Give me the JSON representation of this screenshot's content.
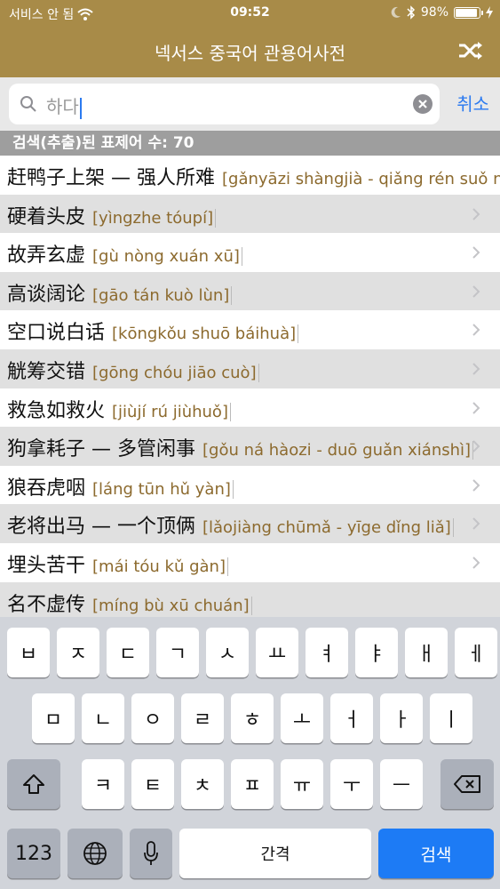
{
  "status": {
    "carrier": "서비스 안 됨",
    "time": "09:52",
    "battery_percent": "98%",
    "battery_level": 0.98
  },
  "nav": {
    "title": "넥서스 중국어 관용어사전",
    "shuffle_icon": "shuffle-icon"
  },
  "search": {
    "query": "하다",
    "cancel_label": "취소"
  },
  "count_label": "검색(추출)된 표제어 수: 70",
  "entries": [
    {
      "hanzi": "赶鸭子上架 — 强人所难",
      "pinyin": "[gǎnyāzi shàngjià - qiǎng rén suǒ nán]"
    },
    {
      "hanzi": "硬着头皮",
      "pinyin": "[yìngzhe tóupí]"
    },
    {
      "hanzi": "故弄玄虚",
      "pinyin": "[gù nòng xuán xū]"
    },
    {
      "hanzi": "高谈阔论",
      "pinyin": "[gāo tán kuò lùn]"
    },
    {
      "hanzi": "空口说白话",
      "pinyin": "[kōngkǒu shuō báihuà]"
    },
    {
      "hanzi": "觥筹交错",
      "pinyin": "[gōng chóu jiāo cuò]"
    },
    {
      "hanzi": "救急如救火",
      "pinyin": "[jiùjí rú jiùhuǒ]"
    },
    {
      "hanzi": "狗拿耗子 — 多管闲事",
      "pinyin": "[gǒu ná hàozi - duō guǎn xiánshì]"
    },
    {
      "hanzi": "狼吞虎咽",
      "pinyin": "[láng tūn hǔ yàn]"
    },
    {
      "hanzi": "老将出马 — 一个顶俩",
      "pinyin": "[lǎojiàng chūmǎ - yīge dǐng liǎ]"
    },
    {
      "hanzi": "埋头苦干",
      "pinyin": "[mái tóu kǔ gàn]"
    },
    {
      "hanzi": "名不虚传",
      "pinyin": "[míng bù xū chuán]"
    }
  ],
  "keyboard": {
    "row1": [
      "ㅂ",
      "ㅈ",
      "ㄷ",
      "ㄱ",
      "ㅅ",
      "ㅛ",
      "ㅕ",
      "ㅑ",
      "ㅐ",
      "ㅔ"
    ],
    "row2": [
      "ㅁ",
      "ㄴ",
      "ㅇ",
      "ㄹ",
      "ㅎ",
      "ㅗ",
      "ㅓ",
      "ㅏ",
      "ㅣ"
    ],
    "row3": [
      "ㅋ",
      "ㅌ",
      "ㅊ",
      "ㅍ",
      "ㅠ",
      "ㅜ",
      "ㅡ"
    ],
    "numbers_label": "123",
    "space_label": "간격",
    "search_label": "검색"
  }
}
